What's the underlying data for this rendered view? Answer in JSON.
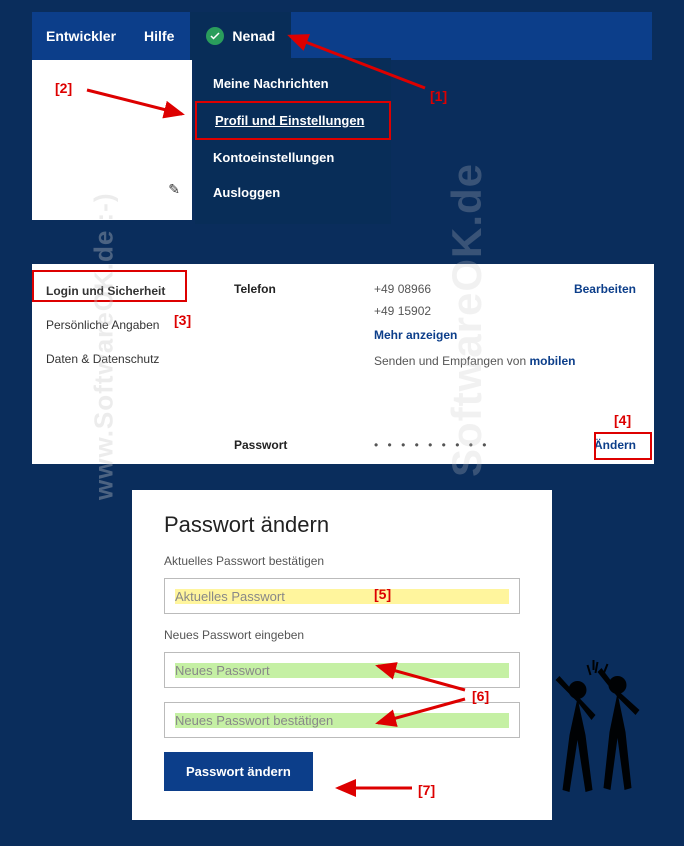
{
  "watermark": "www.SoftwareOK.de :-)",
  "watermark2": "SoftwareOK.de",
  "topnav": {
    "dev": "Entwickler",
    "help": "Hilfe",
    "user": "Nenad"
  },
  "dropdown": {
    "messages": "Meine Nachrichten",
    "profile": "Profil und Einstellungen",
    "account": "Kontoeinstellungen",
    "logout": "Ausloggen"
  },
  "annotations": {
    "a1": "[1]",
    "a2": "[2]",
    "a3": "[3]",
    "a4": "[4]",
    "a5": "[5]",
    "a6": "[6]",
    "a7": "[7]"
  },
  "settings": {
    "sidebar": {
      "login": "Login und Sicherheit",
      "personal": "Persönliche Angaben",
      "privacy": "Daten & Datenschutz"
    },
    "phone_label": "Telefon",
    "phone1": "+49 08966",
    "phone2": "+49 15902",
    "more": "Mehr anzeigen",
    "send_recv_prefix": "Senden und Empfangen von ",
    "send_recv_link": "mobilen",
    "edit": "Bearbeiten",
    "password_label": "Passwort",
    "password_dots": "• • • • • • • • •",
    "change": "Ändern"
  },
  "pwform": {
    "title": "Passwort ändern",
    "confirm_current_label": "Aktuelles Passwort bestätigen",
    "current_placeholder": "Aktuelles Passwort",
    "new_label": "Neues Passwort eingeben",
    "new_placeholder": "Neues Passwort",
    "confirm_new_placeholder": "Neues Passwort bestätigen",
    "submit": "Passwort ändern"
  }
}
